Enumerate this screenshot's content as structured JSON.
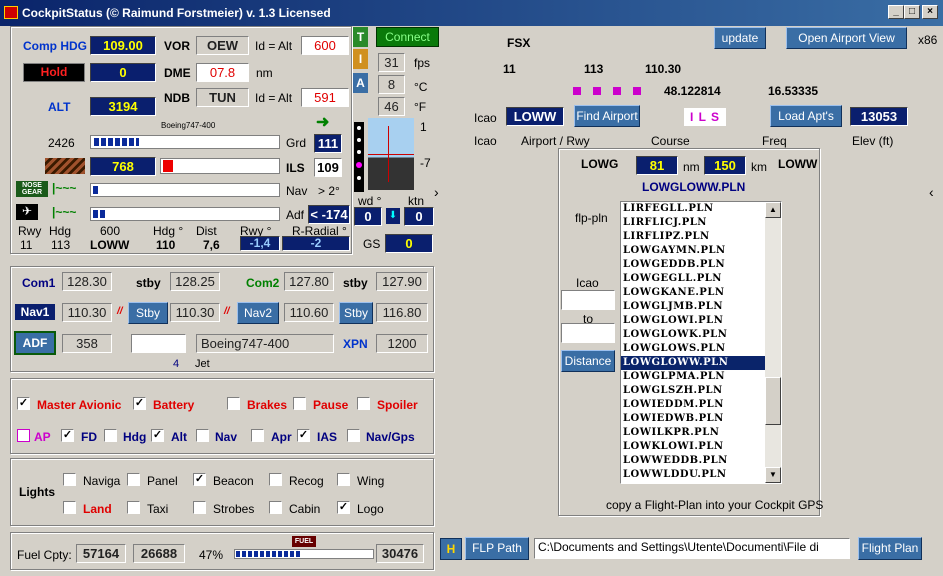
{
  "title": "CockpitStatus (© Raimund Forstmeier) v. 1.3 Licensed",
  "left": {
    "comp_hdg_label": "Comp HDG",
    "comp_hdg": "109.00",
    "vor_label": "VOR",
    "vor": "OEW",
    "id_alt1": "Id = Alt",
    "vor_val": "600",
    "hold_label": "Hold",
    "hold_val": "0",
    "dme_label": "DME",
    "dme": "07.8",
    "nm": "nm",
    "alt_label": "ALT",
    "alt": "3194",
    "ndb_label": "NDB",
    "ndb": "TUN",
    "id_alt2": "Id = Alt",
    "ndb_val": "591",
    "aircraft": "Boeing747-400",
    "grd_num": "2426",
    "grd_label": "Grd",
    "grd_val": "111",
    "ils_num": "768",
    "ils_label": "ILS",
    "ils_val": "109",
    "nose_gear": "NOSE GEAR",
    "nav_label": "Nav",
    "nav_deg": "> 2°",
    "adf_label": "Adf",
    "adf_val": "< -174",
    "bottom_headers": [
      "Rwy",
      "Hdg",
      "600",
      "Hdg °",
      "Dist",
      "Rwy °",
      "R-Radial °"
    ],
    "bottom_values": [
      "11",
      "113",
      "LOWW",
      "110",
      "7,6",
      "-1,4",
      "-2"
    ]
  },
  "indicators": {
    "t": "T",
    "i": "I",
    "a": "A",
    "connect": "Connect",
    "fps_val": "31",
    "fps": "fps",
    "c_val": "8",
    "c": "°C",
    "f_val": "46",
    "f": "°F",
    "wd": "wd °",
    "ktn": "ktn",
    "wd_val": "0",
    "ktn_val": "0",
    "gs": "GS",
    "gs_val": "0",
    "scale1": "1",
    "scale2": "-7"
  },
  "radio": {
    "com1": "Com1",
    "com1_val": "128.30",
    "stby1": "stby",
    "stby1_val": "128.25",
    "com2": "Com2",
    "com2_val": "127.80",
    "stby2": "stby",
    "stby2_val": "127.90",
    "nav1": "Nav1",
    "nav1_val": "110.30",
    "stby_btn": "Stby",
    "nav1_stby": "110.30",
    "nav2": "Nav2",
    "nav2_val": "110.60",
    "stby_btn2": "Stby",
    "nav2_stby": "116.80",
    "adf": "ADF",
    "adf_val": "358",
    "aircraft": "Boeing747-400",
    "xpn": "XPN",
    "xpn_val": "1200",
    "num4": "4",
    "jet": "Jet"
  },
  "switches": {
    "row1": [
      {
        "label": "Master Avionic",
        "checked": true
      },
      {
        "label": "Battery",
        "checked": true
      },
      {
        "label": "Brakes",
        "checked": false
      },
      {
        "label": "Pause",
        "checked": false
      },
      {
        "label": "Spoiler",
        "checked": false
      }
    ],
    "row2": [
      {
        "label": "AP",
        "checked": false
      },
      {
        "label": "FD",
        "checked": true
      },
      {
        "label": "Hdg",
        "checked": false
      },
      {
        "label": "Alt",
        "checked": true
      },
      {
        "label": "Nav",
        "checked": false
      },
      {
        "label": "Apr",
        "checked": false
      },
      {
        "label": "IAS",
        "checked": true
      },
      {
        "label": "Nav/Gps",
        "checked": false
      }
    ]
  },
  "lights": {
    "label": "Lights",
    "items": [
      {
        "label": "Naviga",
        "checked": false
      },
      {
        "label": "Panel",
        "checked": false
      },
      {
        "label": "Beacon",
        "checked": true
      },
      {
        "label": "Recog",
        "checked": false
      },
      {
        "label": "Wing",
        "checked": false
      },
      {
        "label": "Land",
        "checked": false
      },
      {
        "label": "Taxi",
        "checked": false
      },
      {
        "label": "Strobes",
        "checked": false
      },
      {
        "label": "Cabin",
        "checked": false
      },
      {
        "label": "Logo",
        "checked": true
      }
    ]
  },
  "fuel": {
    "label": "Fuel Cpty:",
    "cap": "57164",
    "cur": "26688",
    "pct": "47%",
    "fuel_tag": "FUEL",
    "right": "30476",
    "fill_fraction": 0.47
  },
  "right": {
    "fsx": "FSX",
    "update": "update",
    "open_airport": "Open Airport View",
    "x86": "x86",
    "v1": "11",
    "v2": "113",
    "v3": "110.30",
    "lat": "48.122814",
    "lon": "16.53335",
    "icao_label": "Icao",
    "icao": "LOWW",
    "find": "Find Airport",
    "ils": "I L S",
    "load": "Load Apt's",
    "elev_val": "13053",
    "cols": [
      "Icao",
      "Airport / Rwy",
      "Course",
      "Freq",
      "Elev (ft)"
    ],
    "from": "LOWG",
    "dist1": "81",
    "nm": "nm",
    "dist2": "150",
    "km": "km",
    "to": "LOWW",
    "plan": "LOWGLOWW.PLN",
    "flpln": "flp-pln",
    "icao2": "Icao",
    "to_lbl": "to",
    "distance": "Distance",
    "files": [
      "LIRFEGLL.PLN",
      "LIRFLICJ.PLN",
      "LIRFLIPZ.PLN",
      "LOWGAYMN.PLN",
      "LOWGEDDB.PLN",
      "LOWGEGLL.PLN",
      "LOWGKANE.PLN",
      "LOWGLJMB.PLN",
      "LOWGLOWI.PLN",
      "LOWGLOWK.PLN",
      "LOWGLOWS.PLN",
      "LOWGLOWW.PLN",
      "LOWGLPMA.PLN",
      "LOWGLSZH.PLN",
      "LOWIEDDM.PLN",
      "LOWIEDWB.PLN",
      "LOWILKPR.PLN",
      "LOWKLOWI.PLN",
      "LOWWEDDB.PLN",
      "LOWWLDDU.PLN"
    ],
    "copy_note": "copy a Flight-Plan into your Cockpit GPS",
    "h": "H",
    "flp_path": "FLP Path",
    "path": "C:\\Documents and Settings\\Utente\\Documenti\\File di",
    "flight_plan": "Flight Plan"
  }
}
